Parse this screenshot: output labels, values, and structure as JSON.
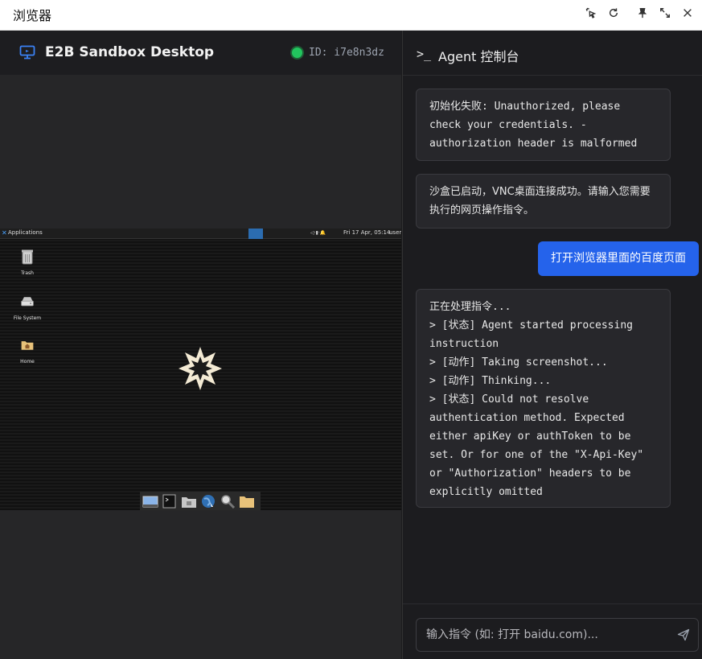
{
  "window": {
    "title": "浏览器"
  },
  "left_panel": {
    "title": "E2B Sandbox Desktop",
    "id_text": "ID: i7e8n3dz",
    "status_color": "#22c55e",
    "vnc": {
      "menu_label": "Applications",
      "clock": "Fri 17 Apr, 05:14",
      "user": "user",
      "desktop_icons": [
        {
          "label": "Trash",
          "icon": "trash-icon"
        },
        {
          "label": "File System",
          "icon": "drive-icon"
        },
        {
          "label": "Home",
          "icon": "home-folder-icon"
        }
      ],
      "dock_icons": [
        "show-desktop-icon",
        "terminal-icon",
        "file-manager-icon",
        "web-browser-icon",
        "search-icon",
        "folder-icon"
      ]
    }
  },
  "right_panel": {
    "prompt_symbol": ">_",
    "title": "Agent 控制台",
    "messages": [
      {
        "role": "system",
        "text": "初始化失败: Unauthorized, please check your credentials. - authorization header is malformed"
      },
      {
        "role": "system",
        "text": "沙盒已启动，VNC桌面连接成功。请输入您需要执行的网页操作指令。"
      },
      {
        "role": "user",
        "text": "打开浏览器里面的百度页面"
      },
      {
        "role": "agent",
        "text": "正在处理指令...\n> [状态] Agent started processing instruction\n> [动作] Taking screenshot...\n> [动作] Thinking...\n> [状态] Could not resolve authentication method. Expected either apiKey or authToken to be set. Or for one of the \"X-Api-Key\" or \"Authorization\" headers to be explicitly omitted"
      }
    ],
    "input": {
      "placeholder": "输入指令 (如: 打开 baidu.com)...",
      "value": ""
    }
  },
  "colors": {
    "accent": "#2563eb",
    "background": "#1c1c1f"
  }
}
